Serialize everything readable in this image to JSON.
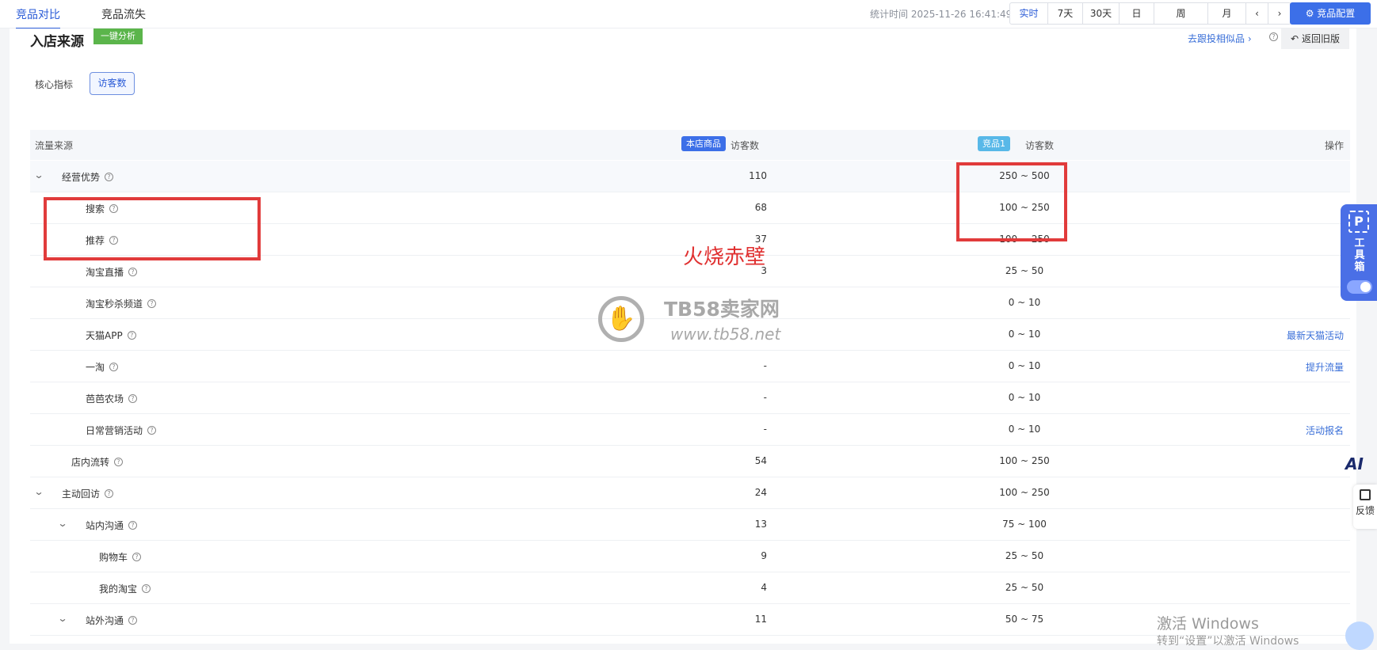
{
  "tabs": [
    {
      "label": "竞品对比",
      "active": true
    },
    {
      "label": "竞品流失",
      "active": false
    }
  ],
  "stat_time": "统计时间 2025-11-26 16:41:49",
  "periods": [
    "实时",
    "7天",
    "30天",
    "日",
    "周",
    "月"
  ],
  "active_period": "实时",
  "config_button": "竞品配置",
  "section": {
    "title": "入店来源",
    "analyze_button": "一键分析",
    "similar_link": "去跟投相似品",
    "back_button": "返回旧版"
  },
  "metric_tabs": [
    "核心指标",
    "访客数"
  ],
  "table": {
    "col_source": "流量来源",
    "tag_self": "本店商品",
    "col_self": "访客数",
    "tag_comp": "竞品1",
    "col_comp": "访客数",
    "col_op": "操作",
    "rows": [
      {
        "name": "经营优势",
        "self": "110",
        "comp": "250 ~ 500",
        "op": "",
        "expand": true
      },
      {
        "name": "搜索",
        "self": "68",
        "comp": "100 ~ 250",
        "op": "",
        "expand": false
      },
      {
        "name": "推荐",
        "self": "37",
        "comp": "100 ~ 250",
        "op": "",
        "expand": false
      },
      {
        "name": "淘宝直播",
        "self": "3",
        "comp": "25 ~ 50",
        "op": "",
        "expand": false
      },
      {
        "name": "淘宝秒杀频道",
        "self": "",
        "comp": "0 ~ 10",
        "op": "",
        "expand": false
      },
      {
        "name": "天猫APP",
        "self": "",
        "comp": "0 ~ 10",
        "op": "最新天猫活动",
        "expand": false
      },
      {
        "name": "一淘",
        "self": "-",
        "comp": "0 ~ 10",
        "op": "提升流量",
        "expand": false
      },
      {
        "name": "芭芭农场",
        "self": "-",
        "comp": "0 ~ 10",
        "op": "",
        "expand": false
      },
      {
        "name": "日常营销活动",
        "self": "-",
        "comp": "0 ~ 10",
        "op": "活动报名",
        "expand": false
      },
      {
        "name": "店内流转",
        "self": "54",
        "comp": "100 ~ 250",
        "op": "",
        "expand": false
      },
      {
        "name": "主动回访",
        "self": "24",
        "comp": "100 ~ 250",
        "op": "",
        "expand": true
      },
      {
        "name": "站内沟通",
        "self": "13",
        "comp": "75 ~ 100",
        "op": "",
        "expand": true
      },
      {
        "name": "购物车",
        "self": "9",
        "comp": "25 ~ 50",
        "op": "",
        "expand": false
      },
      {
        "name": "我的淘宝",
        "self": "4",
        "comp": "25 ~ 50",
        "op": "",
        "expand": false
      },
      {
        "name": "站外沟通",
        "self": "11",
        "comp": "50 ~ 75",
        "op": "",
        "expand": true
      }
    ]
  },
  "watermark": {
    "red_text": "火烧赤壁",
    "logo_text": "TB58卖家网",
    "logo_url": "www.tb58.net"
  },
  "toolbox_label": "工具箱",
  "ai_label": "AI",
  "feedback_label": "反馈",
  "windows_activation": {
    "line1": "激活 Windows",
    "line2": "转到“设置”以激活 Windows"
  }
}
